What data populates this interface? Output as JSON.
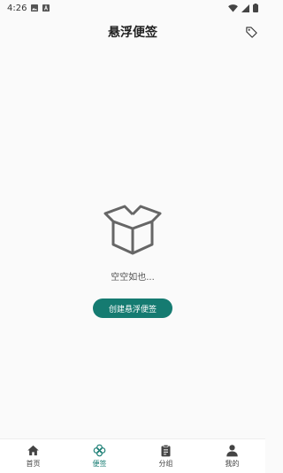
{
  "status_bar": {
    "time": "4:26"
  },
  "header": {
    "title": "悬浮便签",
    "tag_icon": "tag-icon"
  },
  "empty_state": {
    "icon": "empty-box-icon",
    "text": "空空如也...",
    "button_label": "创建悬浮便签"
  },
  "bottom_nav": {
    "items": [
      {
        "label": "首页",
        "icon": "home-icon",
        "active": false
      },
      {
        "label": "便签",
        "icon": "note-flower-icon",
        "active": true
      },
      {
        "label": "分组",
        "icon": "clipboard-icon",
        "active": false
      },
      {
        "label": "我的",
        "icon": "person-icon",
        "active": false
      }
    ]
  },
  "colors": {
    "accent": "#157b71",
    "background": "#fafafa"
  }
}
